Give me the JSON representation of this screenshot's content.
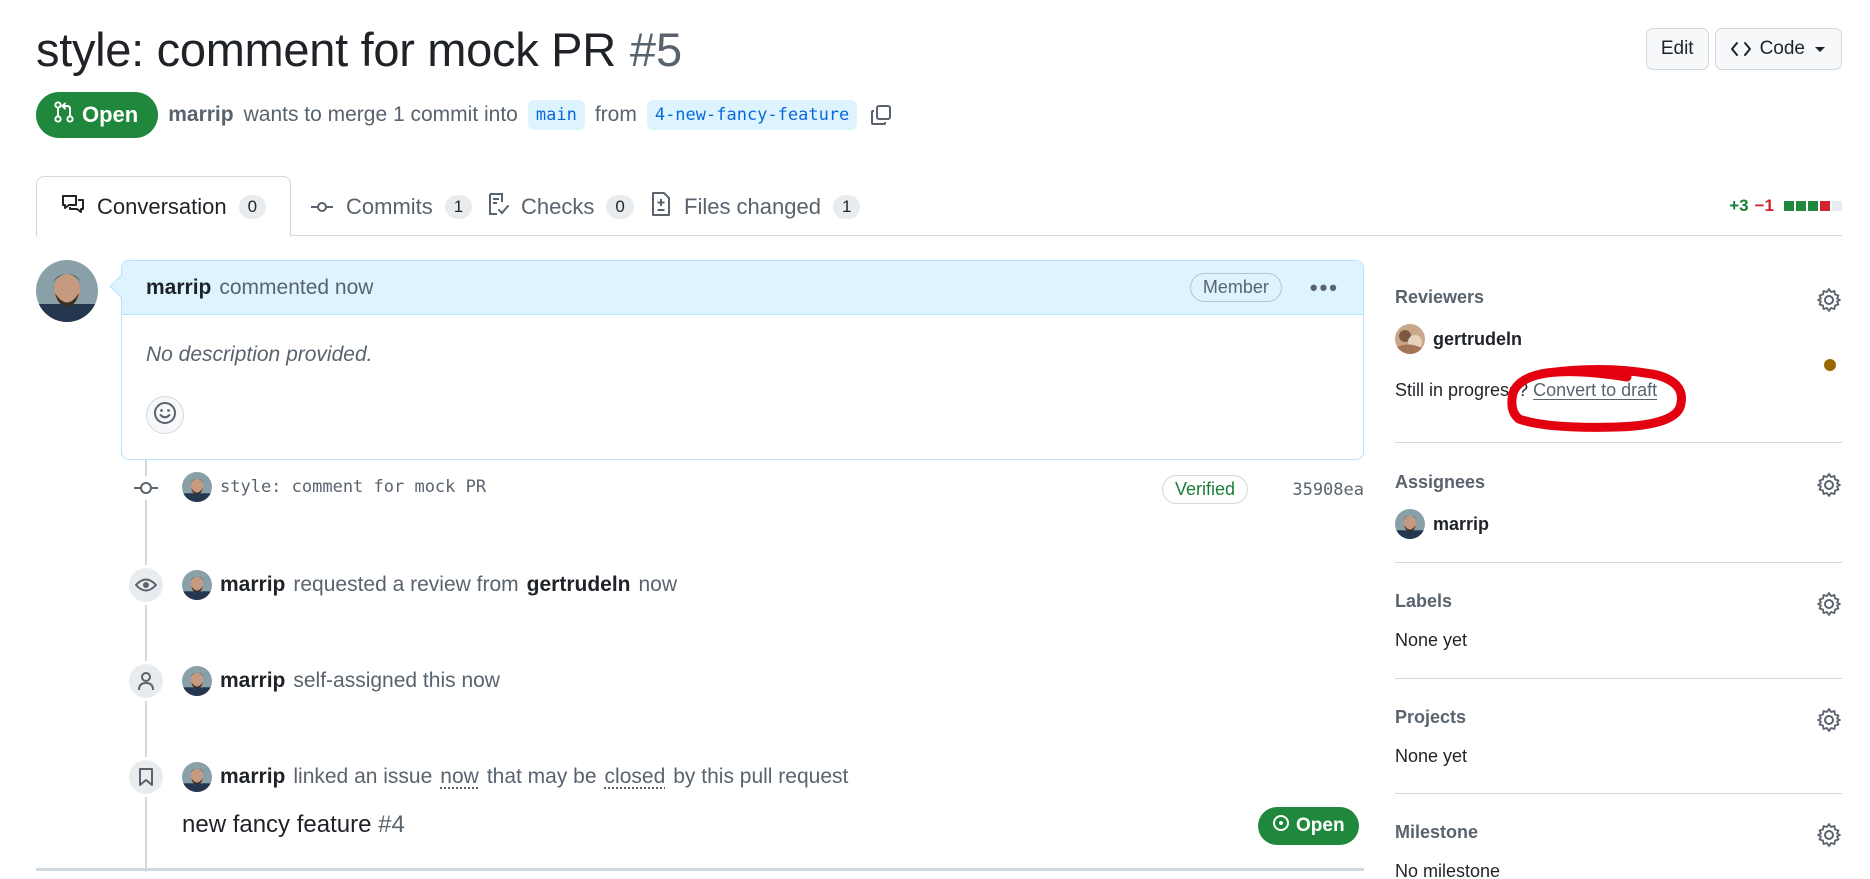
{
  "header": {
    "title": "style: comment for mock PR",
    "number": "#5",
    "edit_label": "Edit",
    "code_label": "Code"
  },
  "state": {
    "badge_label": "Open",
    "author": "marrip",
    "merge_text": "wants to merge 1 commit into",
    "base_branch": "main",
    "from_text": "from",
    "head_branch": "4-new-fancy-feature"
  },
  "tabs": [
    {
      "label": "Conversation",
      "count": "0"
    },
    {
      "label": "Commits",
      "count": "1"
    },
    {
      "label": "Checks",
      "count": "0"
    },
    {
      "label": "Files changed",
      "count": "1"
    }
  ],
  "diffstat": {
    "additions": "+3",
    "deletions": "−1"
  },
  "comment": {
    "author": "marrip",
    "action": "commented now",
    "badge": "Member",
    "body": "No description provided."
  },
  "timeline": {
    "commit": {
      "message": "style: comment for mock PR",
      "verified": "Verified",
      "sha": "35908ea"
    },
    "review_request": {
      "who": "marrip",
      "text": "requested a review from",
      "reviewer": "gertrudeln",
      "time": "now"
    },
    "self_assign": {
      "who": "marrip",
      "text": "self-assigned this now"
    },
    "linked_issue": {
      "who": "marrip",
      "text1": "linked an issue",
      "time": "now",
      "text2": "that may be",
      "closed": "closed",
      "text3": "by this pull request",
      "issue_title": "new fancy feature",
      "issue_number": "#4",
      "issue_state": "Open"
    }
  },
  "sidebar": {
    "reviewers": {
      "heading": "Reviewers",
      "name": "gertrudeln",
      "draft_prefix": "Still in progress?",
      "draft_link": "Convert to draft"
    },
    "assignees": {
      "heading": "Assignees",
      "name": "marrip"
    },
    "labels": {
      "heading": "Labels",
      "value": "None yet"
    },
    "projects": {
      "heading": "Projects",
      "value": "None yet"
    },
    "milestone": {
      "heading": "Milestone",
      "value": "No milestone"
    }
  },
  "colors": {
    "open_green": "#1f883d",
    "link_blue": "#0969da",
    "annotation_red": "#e3000f",
    "pending_amber": "#9a6700"
  }
}
